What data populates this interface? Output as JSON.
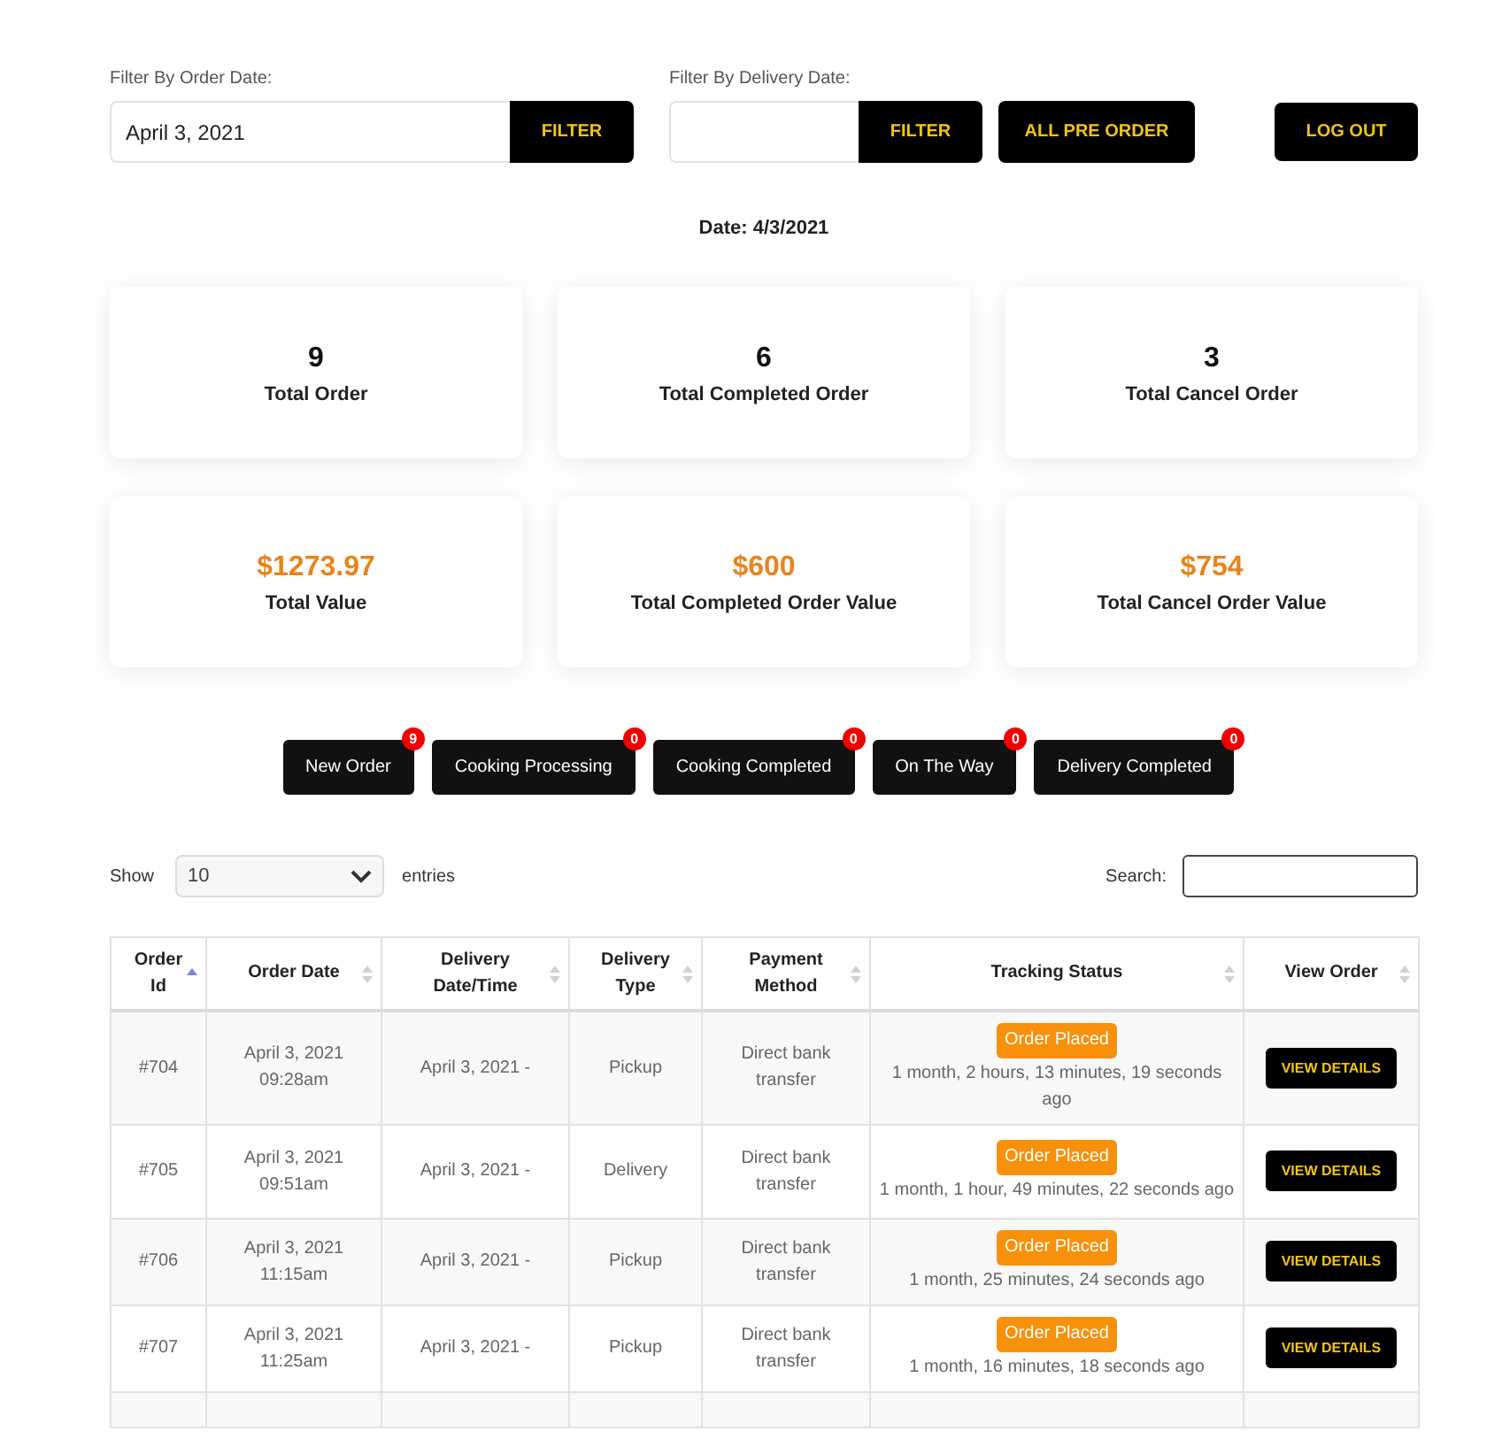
{
  "filters": [
    {
      "label": "Filter By Order Date:",
      "value": "April 3, 2021",
      "button": "FILTER"
    },
    {
      "label": "Filter By Delivery Date:",
      "button": "FILTER"
    }
  ],
  "all_pre_order_button": "ALL PRE ORDER",
  "logout_button": "LOG OUT",
  "date_heading": "Date: 4/3/2021",
  "stat_cards": [
    {
      "value": "9",
      "label": "Total Order",
      "kind": "count"
    },
    {
      "value": "6",
      "label": "Total Completed Order",
      "kind": "count"
    },
    {
      "value": "3",
      "label": "Total Cancel Order",
      "kind": "count"
    },
    {
      "value": "$1273.97",
      "label": "Total Value",
      "kind": "money"
    },
    {
      "value": "$600",
      "label": "Total Completed Order Value",
      "kind": "money"
    },
    {
      "value": "$754",
      "label": "Total Cancel Order Value",
      "kind": "money"
    }
  ],
  "status_buttons": [
    {
      "label": "New Order",
      "count": "9"
    },
    {
      "label": "Cooking Processing",
      "count": "0"
    },
    {
      "label": "Cooking Completed",
      "count": "0"
    },
    {
      "label": "On The Way",
      "count": "0"
    },
    {
      "label": "Delivery Completed",
      "count": "0"
    }
  ],
  "length_control": {
    "before": "Show",
    "value": "10",
    "after": "entries"
  },
  "search": {
    "label": "Search:"
  },
  "table": {
    "columns": [
      {
        "label": "Order Id",
        "sorted_ascending": true
      },
      {
        "label": "Order Date",
        "sorted_ascending": false
      },
      {
        "label": "Delivery Date/Time",
        "sorted_ascending": false
      },
      {
        "label": "Delivery Type",
        "sorted_ascending": false
      },
      {
        "label": "Payment Method",
        "sorted_ascending": false
      },
      {
        "label": "Tracking Status",
        "sorted_ascending": false
      },
      {
        "label": "View Order",
        "sorted_ascending": false
      }
    ],
    "rows": [
      {
        "id": "#704",
        "order_date": "April 3, 2021 09:28am",
        "delivery": "April 3, 2021 -",
        "type": "Pickup",
        "payment": "Direct bank transfer",
        "status": "Order Placed",
        "elapsed": "1 month, 2 hours, 13 minutes, 19 seconds ago",
        "action": "VIEW DETAILS"
      },
      {
        "id": "#705",
        "order_date": "April 3, 2021 09:51am",
        "delivery": "April 3, 2021 -",
        "type": "Delivery",
        "payment": "Direct bank transfer",
        "status": "Order Placed",
        "elapsed": "1 month, 1 hour, 49 minutes, 22 seconds ago",
        "action": "VIEW DETAILS"
      },
      {
        "id": "#706",
        "order_date": "April 3, 2021 11:15am",
        "delivery": "April 3, 2021 -",
        "type": "Pickup",
        "payment": "Direct bank transfer",
        "status": "Order Placed",
        "elapsed": "1 month, 25 minutes, 24 seconds ago",
        "action": "VIEW DETAILS"
      },
      {
        "id": "#707",
        "order_date": "April 3, 2021 11:25am",
        "delivery": "April 3, 2021 -",
        "type": "Pickup",
        "payment": "Direct bank transfer",
        "status": "Order Placed",
        "elapsed": "1 month, 16 minutes, 18 seconds ago",
        "action": "VIEW DETAILS"
      }
    ]
  }
}
